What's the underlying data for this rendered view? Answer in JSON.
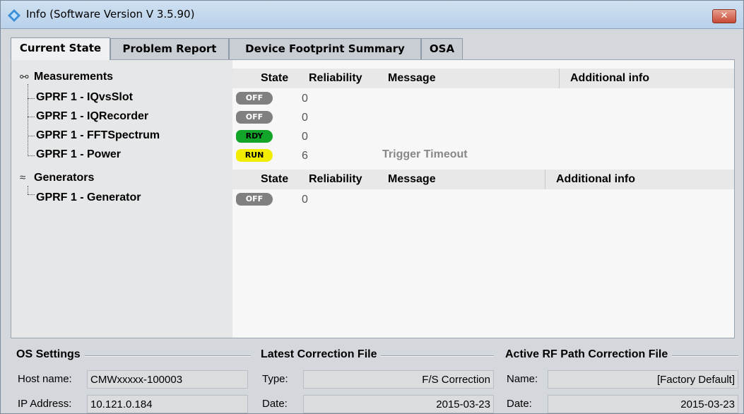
{
  "window": {
    "title": "Info (Software Version V 3.5.90)",
    "close_label": "✕"
  },
  "tabs": [
    {
      "label": "Current State",
      "active": true
    },
    {
      "label": "Problem Report",
      "active": false
    },
    {
      "label": "Device Footprint Summary",
      "active": false
    },
    {
      "label": "OSA",
      "active": false
    }
  ],
  "measurements": {
    "title": "Measurements",
    "columns": {
      "state": "State",
      "reliability": "Reliability",
      "message": "Message",
      "additional": "Additional info"
    },
    "items": [
      {
        "name": "GPRF 1 - IQvsSlot",
        "state": "OFF",
        "reliability": "0",
        "message": ""
      },
      {
        "name": "GPRF 1 - IQRecorder",
        "state": "OFF",
        "reliability": "0",
        "message": ""
      },
      {
        "name": "GPRF 1 - FFTSpectrum",
        "state": "RDY",
        "reliability": "0",
        "message": ""
      },
      {
        "name": "GPRF 1 - Power",
        "state": "RUN",
        "reliability": "6",
        "message": "Trigger Timeout"
      }
    ]
  },
  "generators": {
    "title": "Generators",
    "columns": {
      "state": "State",
      "reliability": "Reliability",
      "message": "Message",
      "additional": "Additional info"
    },
    "items": [
      {
        "name": "GPRF 1 - Generator",
        "state": "OFF",
        "reliability": "0",
        "message": ""
      }
    ]
  },
  "os_settings": {
    "title": "OS Settings",
    "host_label": "Host name:",
    "host_value": "CMWxxxxx-100003",
    "ip_label": "IP Address:",
    "ip_value": "10.121.0.184"
  },
  "latest_correction": {
    "title": "Latest Correction File",
    "type_label": "Type:",
    "type_value": "F/S Correction",
    "date_label": "Date:",
    "date_value": "2015-03-23"
  },
  "active_rf": {
    "title": "Active RF Path Correction File",
    "name_label": "Name:",
    "name_value": "[Factory Default]",
    "date_label": "Date:",
    "date_value": "2015-03-23"
  },
  "colors": {
    "off_badge": "#808080",
    "rdy_badge": "#12a52a",
    "run_badge": "#f2ec00",
    "close_button": "#c74a35"
  }
}
